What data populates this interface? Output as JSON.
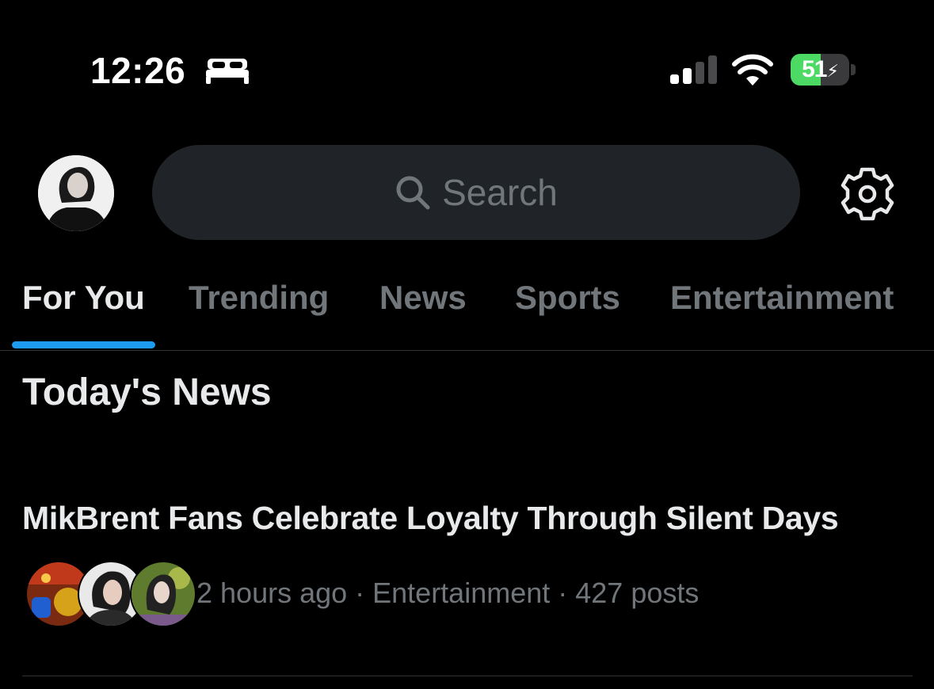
{
  "status_bar": {
    "time": "12:26",
    "battery_level": "51",
    "battery_fraction": 0.51,
    "battery_color": "#4cd964",
    "icons": [
      "sleep-bed-icon",
      "cellular-signal-icon",
      "wifi-icon",
      "battery-charging-icon"
    ]
  },
  "header": {
    "search_placeholder": "Search",
    "avatar_icon": "profile-avatar",
    "settings_icon": "gear-icon"
  },
  "tabs": [
    {
      "label": "For You",
      "active": true
    },
    {
      "label": "Trending",
      "active": false
    },
    {
      "label": "News",
      "active": false
    },
    {
      "label": "Sports",
      "active": false
    },
    {
      "label": "Entertainment",
      "active": false
    }
  ],
  "section": {
    "title": "Today's News"
  },
  "news": [
    {
      "headline": "MikBrent Fans Celebrate Loyalty Through Silent Days",
      "meta": "2 hours ago · Entertainment · 427 posts",
      "avatar_count": 3
    }
  ],
  "colors": {
    "background": "#000000",
    "accent": "#1d9bf0",
    "text_primary": "#e7e9ea",
    "text_secondary": "#71767b",
    "search_bg": "#202327"
  }
}
